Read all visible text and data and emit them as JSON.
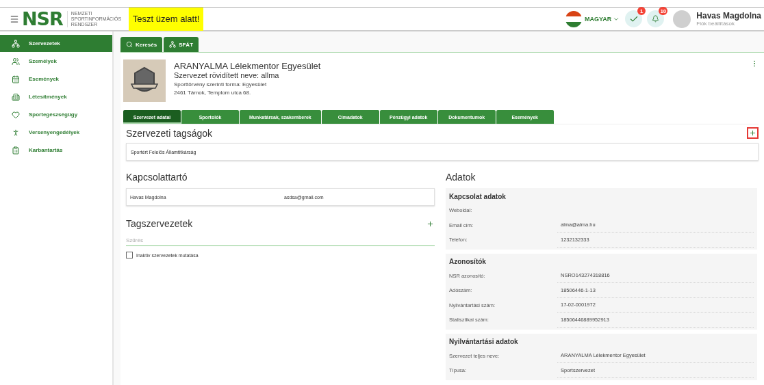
{
  "header": {
    "logo": "NSR",
    "logo_subtitle": [
      "NEMZETI",
      "SPORTINFORMÁCIÓS",
      "RENDSZER"
    ],
    "banner": "Teszt üzem alatt!",
    "language": "MAGYAR",
    "tasks_badge": "1",
    "notifications_badge": "10",
    "user_name": "Havas Magdolna",
    "user_link": "Fiók beállítások"
  },
  "sidebar": {
    "items": [
      {
        "label": "Szervezetek",
        "selected": true
      },
      {
        "label": "Személyek",
        "selected": false
      },
      {
        "label": "Események",
        "selected": false
      },
      {
        "label": "Létesítmények",
        "selected": false
      },
      {
        "label": "Sportegészségügy",
        "selected": false
      },
      {
        "label": "Versenyengedélyek",
        "selected": false
      },
      {
        "label": "Karbantartás",
        "selected": false
      }
    ]
  },
  "top_tabs": [
    {
      "label": "Keresés"
    },
    {
      "label": "SFÁT"
    }
  ],
  "organization": {
    "name": "ARANYALMA Lélekmentor Egyesület",
    "short_name": "Szervezet rövidített neve: allma",
    "legal_form": "Sporttörvény szerinti forma: Egyesület",
    "address": "2461 Tárnok, Templom utca 68."
  },
  "section_tabs": [
    {
      "label": "Szervezet adatai",
      "selected": true
    },
    {
      "label": "Sportolók",
      "selected": false
    },
    {
      "label": "Munkatársak, szakemberek",
      "selected": false
    },
    {
      "label": "Címadatok",
      "selected": false
    },
    {
      "label": "Pénzügyi adatok",
      "selected": false
    },
    {
      "label": "Dokumentumok",
      "selected": false
    },
    {
      "label": "Események",
      "selected": false
    }
  ],
  "memberships": {
    "title": "Szervezeti tagságok",
    "items": [
      "Sportért Felelős Államtitkárság"
    ]
  },
  "contact": {
    "title": "Kapcsolattartó",
    "name": "Havas Magdolna",
    "email": "asdsa@gmail.com"
  },
  "member_orgs": {
    "title": "Tagszervezetek",
    "filter_placeholder": "Szűrés",
    "checkbox_label": "Inaktív szervezetek mutatása",
    "checked": false
  },
  "details": {
    "title": "Adatok",
    "groups": [
      {
        "title": "Kapcsolat adatok",
        "rows": [
          {
            "label": "Weboldal:"
          },
          {
            "label": "Email cím:",
            "value": "alma@alma.hu"
          },
          {
            "label": "Telefon:",
            "value": "1232132333"
          }
        ]
      },
      {
        "title": "Azonosítók",
        "rows": [
          {
            "label": "NSR azonosító:",
            "value": "NSRO143274318816"
          },
          {
            "label": "Adószám:",
            "value": "18506446-1-13"
          },
          {
            "label": "Nyilvántartási szám:",
            "value": "17-02-0001972"
          },
          {
            "label": "Statisztikai szám:",
            "value": "18506446889952913"
          }
        ]
      },
      {
        "title": "Nyilvántartási adatok",
        "rows": [
          {
            "label": "Szervezet teljes neve:",
            "value": "ARANYALMA Lélekmentor Egyesület"
          },
          {
            "label": "Típusa:",
            "value": "Sportszervezet"
          }
        ]
      }
    ]
  }
}
